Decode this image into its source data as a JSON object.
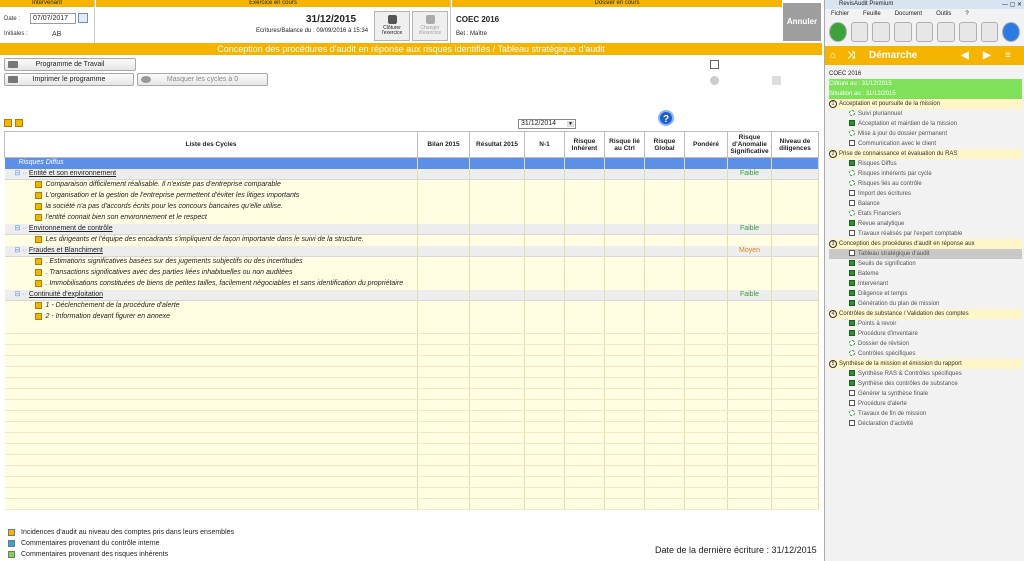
{
  "header": {
    "intervenant": {
      "caption": "Intervenant",
      "date_label": "Date :",
      "date_value": "07/07/2017",
      "initiales_label": "Initiales :",
      "initiales_value": "AB"
    },
    "exercice": {
      "caption": "Exercice en cours",
      "date": "31/12/2015",
      "sub": "Ecritures/Balance du :  09/09/2016 à 15:34",
      "cloturer": "Clôturer l'exercice",
      "changer": "Changer d'exercice"
    },
    "dossier": {
      "caption": "Dossier en cours",
      "name": "COEC 2016",
      "bet": "Bet :  Maître"
    },
    "annuler": "Annuler"
  },
  "title": "Conception des procédures d'audit en réponse aux risques identifiés / Tableau stratégique d'audit",
  "buttons": {
    "programme_travail": "Programme de Travail",
    "imprimer": "Imprimer le programme",
    "masquer": "Masquer les cycles à 0"
  },
  "year_select": "31/12/2014",
  "help": "?",
  "columns": [
    "Liste des Cycles",
    "Bilan 2015",
    "Résultat 2015",
    "N-1",
    "Risque Inhérent",
    "Risque lié au Ctrl",
    "Risque Global",
    "Pondéré",
    "Risque d'Anomalie Significative",
    "Niveau de diligences"
  ],
  "rows": [
    {
      "kind": "group",
      "label": "Risques Diffus",
      "level": ""
    },
    {
      "kind": "sec",
      "label": "Entité et son environnement",
      "level": "Faible",
      "lvl": "faible"
    },
    {
      "kind": "item",
      "label": "Comparaison difficilement réalisable. Il n'existe pas d'entreprise comparable",
      "level": ""
    },
    {
      "kind": "item",
      "label": "L'organisation et la gestion de l'entreprise permettent d'éviter les litiges importants",
      "level": ""
    },
    {
      "kind": "item",
      "label": "la société n'a pas d'accords écrits pour les concours bancaires qu'elle utilise.",
      "level": ""
    },
    {
      "kind": "item",
      "label": "l'entité connait bien son environnement et le respect",
      "level": ""
    },
    {
      "kind": "sec",
      "label": "Environnement de contrôle",
      "level": "Faible",
      "lvl": "faible"
    },
    {
      "kind": "item",
      "label": "Les dirigeants et l'équipe des encadrants s'impliquent de façon importante dans le suivi de la structure.",
      "level": ""
    },
    {
      "kind": "sec",
      "label": "Fraudes et Blanchiment",
      "level": "Moyen",
      "lvl": "moyen"
    },
    {
      "kind": "item",
      "label": ". Estimations significatives basées sur des jugements subjectifs ou des incertitudes",
      "level": ""
    },
    {
      "kind": "item",
      "label": ". Transactions significatives avec des parties liées inhabituelles ou non auditées",
      "level": ""
    },
    {
      "kind": "item",
      "label": ". Immobilisations constituées de biens de petites tailles, facilement négociables et sans identification du propriétaire",
      "level": ""
    },
    {
      "kind": "sec",
      "label": "Continuité d'exploitation",
      "level": "Faible",
      "lvl": "faible"
    },
    {
      "kind": "item",
      "label": "1 - Déclenchement de la procédure d'alerte",
      "level": ""
    },
    {
      "kind": "item",
      "label": "2 - Information devant figurer en annexe",
      "level": ""
    }
  ],
  "legend": [
    {
      "label": "Incidences d'audit au niveau des comptes pris dans leurs ensembles",
      "color": "#f5b400"
    },
    {
      "label": "Commentaires provenant du contrôle interne",
      "color": "#2aa7d8"
    },
    {
      "label": "Commentaires provenant des risques inhérents",
      "color": "#7fd35a"
    }
  ],
  "last_date": "Date de la dernière écriture : 31/12/2015",
  "panel": {
    "app_title": "RevisAudit Premium",
    "menu": [
      "Fichier",
      "Feuille",
      "Document",
      "Outils",
      "?"
    ],
    "demarche": "Démarche",
    "dossier": "COEC 2016",
    "cloture": "Clôture au :    31/12/2015",
    "situation": "Situation au :    31/12/2015",
    "items": [
      {
        "t": "sec",
        "n": "1",
        "label": "Acceptation et poursuite de la mission"
      },
      {
        "t": "sub",
        "s": "dash",
        "label": "Suivi pluriannuel"
      },
      {
        "t": "sub",
        "s": "done",
        "label": "Acceptation et maintien de la mission"
      },
      {
        "t": "sub",
        "s": "dash",
        "label": "Mise à jour du dossier permanent"
      },
      {
        "t": "sub",
        "s": "todo",
        "label": "Communication avec le client"
      },
      {
        "t": "sec",
        "n": "2",
        "label": "Prise de connaissance et évaluation du RAS"
      },
      {
        "t": "sub",
        "s": "done",
        "label": "Risques Diffus"
      },
      {
        "t": "sub",
        "s": "dash",
        "label": "Risques inhérents par cycle"
      },
      {
        "t": "sub",
        "s": "dash",
        "label": "Risques liés au contrôle"
      },
      {
        "t": "sub",
        "s": "todo",
        "label": "Import des écritures"
      },
      {
        "t": "sub",
        "s": "todo",
        "label": "Balance"
      },
      {
        "t": "sub",
        "s": "dash",
        "label": "Etats Financiers"
      },
      {
        "t": "sub",
        "s": "done",
        "label": "Revue analytique"
      },
      {
        "t": "sub",
        "s": "todo",
        "label": "Travaux réalisés par l'expert comptable"
      },
      {
        "t": "sec",
        "n": "3",
        "label": "Conception des procédures d'audit en réponse aux"
      },
      {
        "t": "sub sel",
        "s": "todo",
        "label": "Tableau stratégique d'audit"
      },
      {
        "t": "sub",
        "s": "done",
        "label": "Seuils de signification"
      },
      {
        "t": "sub",
        "s": "done",
        "label": "Bateme"
      },
      {
        "t": "sub",
        "s": "done",
        "label": "Intervenant"
      },
      {
        "t": "sub",
        "s": "done",
        "label": "Diligence et temps"
      },
      {
        "t": "sub",
        "s": "done",
        "label": "Génération du plan de mission"
      },
      {
        "t": "sec",
        "n": "4",
        "label": "Contrôles de substance / Validation des comptes"
      },
      {
        "t": "sub",
        "s": "done",
        "label": "Points à revoir"
      },
      {
        "t": "sub",
        "s": "done",
        "label": "Procédure d'inventaire"
      },
      {
        "t": "sub",
        "s": "dash",
        "label": "Dossier de révision"
      },
      {
        "t": "sub",
        "s": "dash",
        "label": "Contrôles spécifiques"
      },
      {
        "t": "sec",
        "n": "5",
        "label": "Synthèse de la mission et émission du rapport"
      },
      {
        "t": "sub",
        "s": "done",
        "label": "Synthèse RAS & Contrôles spécifiques"
      },
      {
        "t": "sub",
        "s": "done",
        "label": "Synthèse des contrôles de substance"
      },
      {
        "t": "sub",
        "s": "todo",
        "label": "Générer la synthèse finale"
      },
      {
        "t": "sub",
        "s": "todo",
        "label": "Procédure d'alerte"
      },
      {
        "t": "sub",
        "s": "dash",
        "label": "Travaux de fin de mission"
      },
      {
        "t": "sub",
        "s": "todo",
        "label": "Déclaration d'activité"
      }
    ]
  }
}
